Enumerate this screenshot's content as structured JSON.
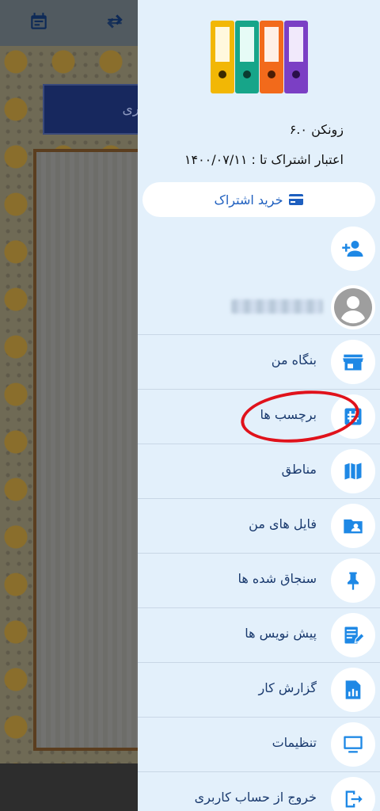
{
  "drawer": {
    "app_name": "زونکن ۶.۰",
    "subscription_valid": "اعتبار اشتراک تا : ۱۴۰۰/۰۷/۱۱",
    "buy_button_label": "خرید اشتراک",
    "buy_button_icon": "credit-card-icon",
    "add_user_icon": "person-add-icon",
    "avatar_icon": "account-circle-icon"
  },
  "menu": [
    {
      "label": "بنگاه من",
      "icon": "store-icon"
    },
    {
      "label": "برچسب ها",
      "icon": "tag-icon"
    },
    {
      "label": "مناطق",
      "icon": "map-icon"
    },
    {
      "label": "فایل های من",
      "icon": "folder-shared-icon"
    },
    {
      "label": "سنجاق شده ها",
      "icon": "pin-icon"
    },
    {
      "label": "پیش نویس ها",
      "icon": "draft-icon"
    },
    {
      "label": "گزارش کار",
      "icon": "report-icon"
    },
    {
      "label": "تنظیمات",
      "icon": "monitor-icon"
    },
    {
      "label": "خروج از حساب کاربری",
      "icon": "logout-icon"
    }
  ],
  "background": {
    "banner_text": "ری"
  },
  "colors": {
    "accent": "#1e88e5",
    "menu_text": "#1a3a6e",
    "drawer_bg": "#e3f0fb",
    "annotation": "#e0121b"
  }
}
